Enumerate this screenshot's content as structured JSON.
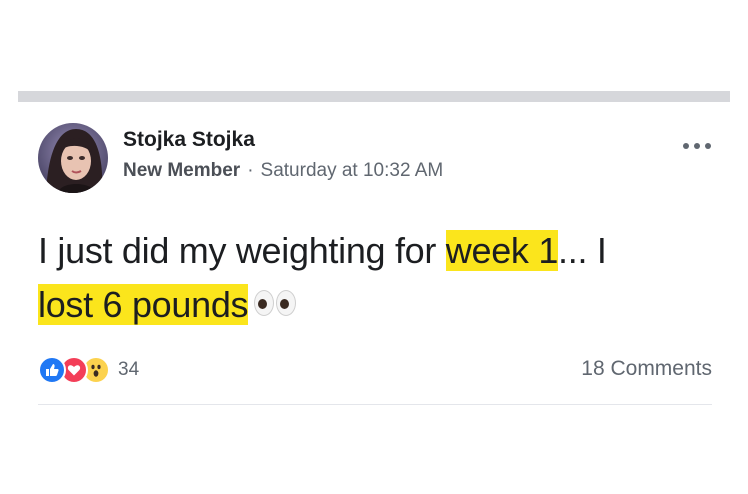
{
  "post": {
    "author": "Stojka Stojka",
    "role": "New Member",
    "separator": "·",
    "timestamp": "Saturday at 10:32 AM",
    "text_part1": "I just did my weighting for ",
    "highlight1": "week 1",
    "text_part2": "... I",
    "highlight2": "lost 6 pounds",
    "emoji_icon": "eyes-icon",
    "highlight_color": "#fbe51c"
  },
  "reactions": {
    "icons": [
      "like-icon",
      "love-icon",
      "wow-icon"
    ],
    "count": "34",
    "colors": {
      "like": "#2078f4",
      "love": "#f33e58",
      "wow": "#fcd24e"
    }
  },
  "comments": {
    "label": "18 Comments"
  }
}
